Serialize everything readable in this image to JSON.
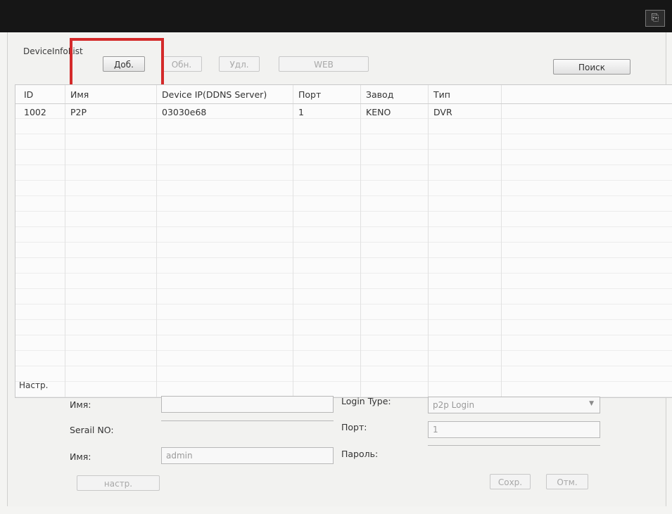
{
  "topbar": {
    "exit_icon": "exit-icon"
  },
  "device_list": {
    "label": "DeviceInfoList",
    "buttons": {
      "add": "Доб.",
      "refresh": "Обн.",
      "delete": "Удл.",
      "web": "WEB",
      "search": "Поиск"
    },
    "columns": [
      "ID",
      "Имя",
      "Device IP(DDNS Server)",
      "Порт",
      "Завод",
      "Тип"
    ],
    "rows": [
      {
        "id": "1002",
        "name": "P2P",
        "device_ip": "03030e68",
        "port": "1",
        "manufacturer": "KENO",
        "type": "DVR"
      }
    ]
  },
  "settings": {
    "label": "Настр.",
    "name_label": "Имя:",
    "name_value": "",
    "serial_label": "Serail NO:",
    "serial_value": "",
    "user_label": "Имя:",
    "user_value": "admin",
    "login_type_label": "Login Type:",
    "login_type_value": "p2p Login",
    "port_label": "Порт:",
    "port_value": "1",
    "password_label": "Пароль:",
    "password_value": "",
    "config_button": "настр.",
    "save_button": "Сохр.",
    "cancel_button": "Отм."
  }
}
